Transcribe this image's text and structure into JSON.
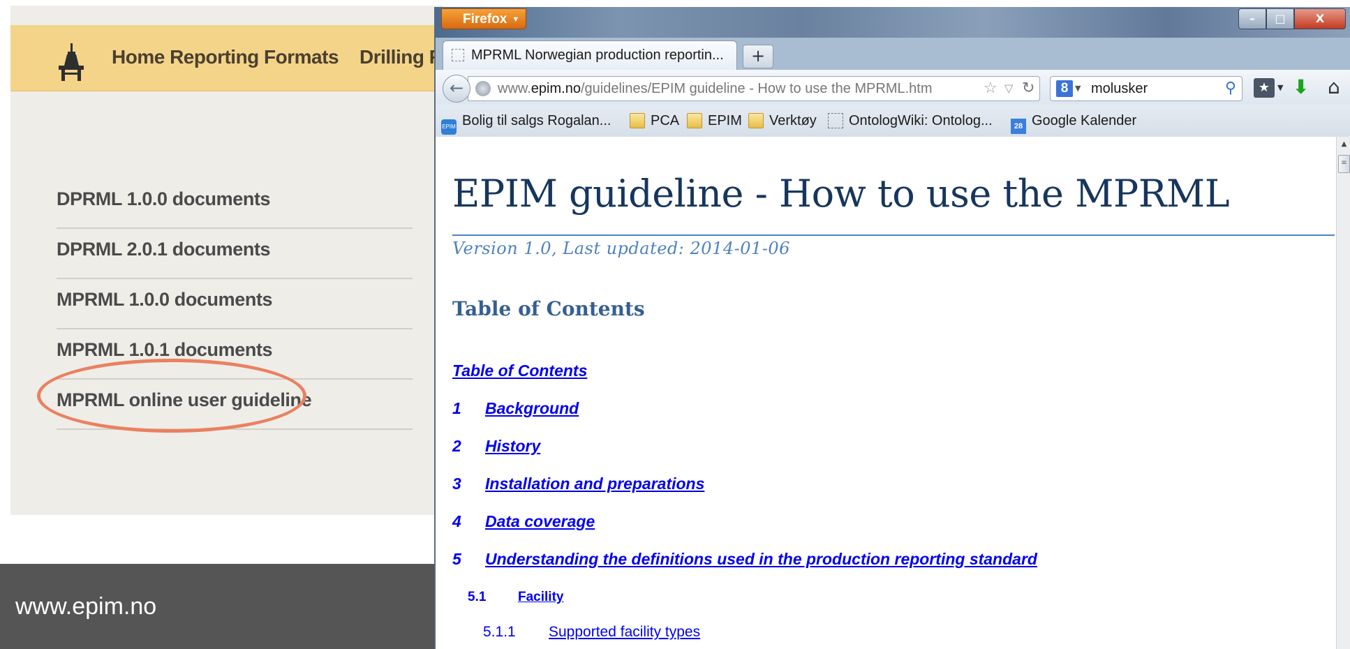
{
  "background_site": {
    "nav": {
      "home_formats": "Home Reporting Formats",
      "drilling": "Drilling F"
    },
    "documents": [
      "DPRML 1.0.0 documents",
      "DPRML 2.0.1 documents",
      "MPRML 1.0.0 documents",
      "MPRML 1.0.1 documents",
      "MPRML online user guideline"
    ],
    "highlight_color": "#ea8060",
    "header_color": "#f4d489"
  },
  "footer": {
    "url": "www.epim.no"
  },
  "browser": {
    "menu_button": "Firefox",
    "window_controls": {
      "minimize": "–",
      "maximize": "□",
      "close": "X"
    },
    "tab": {
      "title": "MPRML Norwegian production reportin...",
      "new_tab": "+"
    },
    "url": {
      "domain_prefix": "www.",
      "domain": "epim.no",
      "path": "/guidelines/EPIM guideline - How to use the MPRML.htm"
    },
    "search": {
      "engine_icon": "8",
      "query": "molusker"
    },
    "bookmarks": [
      {
        "label": "Bolig til salgs Rogalan...",
        "icon": "epim-favicon",
        "icon_text": "EPIM"
      },
      {
        "label": "PCA",
        "icon": "folder-icon"
      },
      {
        "label": "EPIM",
        "icon": "folder-icon"
      },
      {
        "label": "Verktøy",
        "icon": "folder-icon"
      },
      {
        "label": "OntologWiki: Ontolog...",
        "icon": "blank-page-icon"
      },
      {
        "label": "Google Kalender",
        "icon": "calendar-icon",
        "icon_text": "28"
      }
    ]
  },
  "document": {
    "title": "EPIM guideline - How to use the MPRML",
    "version": "Version 1.0, Last updated: 2014-01-06",
    "toc_heading": "Table of Contents",
    "toc_links": [
      {
        "num": "",
        "text": "Table of Contents"
      },
      {
        "num": "1",
        "text": "Background"
      },
      {
        "num": "2",
        "text": "History"
      },
      {
        "num": "3",
        "text": "Installation and preparations"
      },
      {
        "num": "4",
        "text": "Data coverage"
      },
      {
        "num": "5",
        "text": "Understanding the definitions used in the production reporting standard"
      }
    ],
    "toc_sub": {
      "num": "5.1",
      "text": "Facility"
    },
    "toc_subsub": {
      "num": "5.1.1",
      "text": "Supported facility types"
    }
  }
}
